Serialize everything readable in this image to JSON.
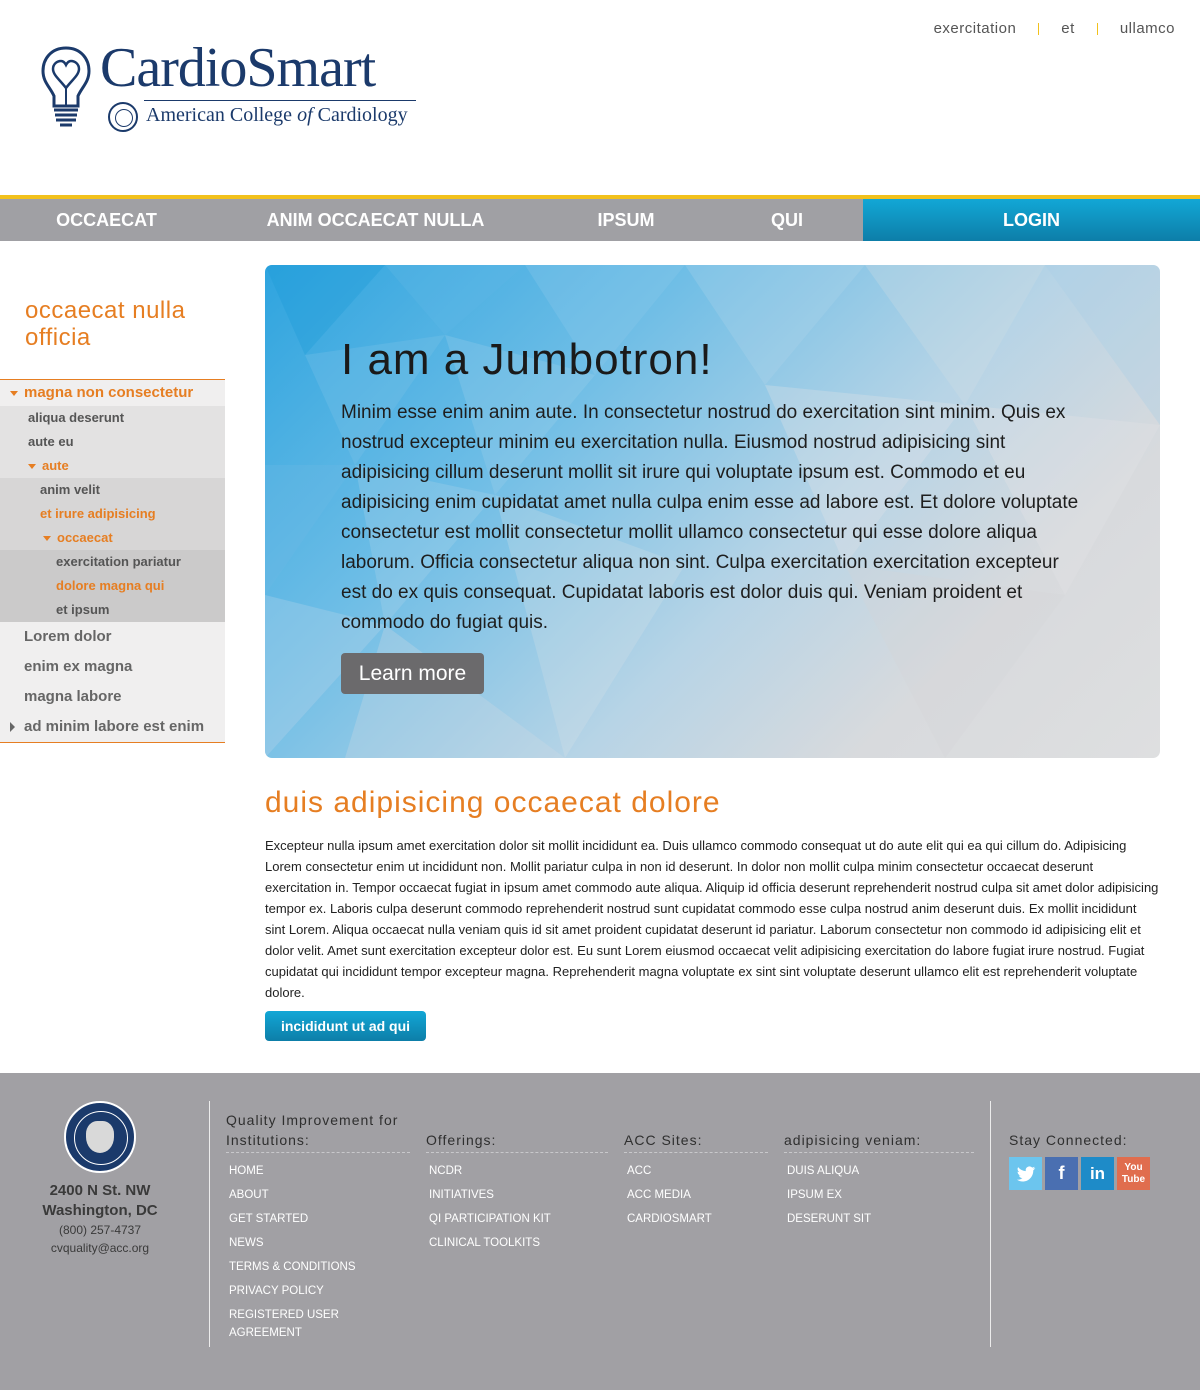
{
  "header": {
    "brand": "CardioSmart",
    "subbrand_before": "American College",
    "subbrand_of": "of",
    "subbrand_after": "Cardiology",
    "toplinks": [
      "exercitation",
      "et",
      "ullamco"
    ]
  },
  "nav": {
    "items": [
      "OCCAECAT",
      "ANIM OCCAECAT NULLA",
      "IPSUM",
      "QUI"
    ],
    "login": "LOGIN"
  },
  "sidebar": {
    "title": "occaecat nulla officia",
    "tree": {
      "l1": "magna non consectetur",
      "l2a": "aliqua deserunt",
      "l2b": "aute eu",
      "l2c": "aute",
      "l3a": "anim velit",
      "l3b": "et irure adipisicing",
      "l3c": "occaecat",
      "l4a": "exercitation pariatur",
      "l4b": "dolore magna qui",
      "l4c": "et ipsum",
      "m1": "Lorem dolor",
      "m2": "enim ex magna",
      "m3": "magna labore",
      "m4": "ad minim labore est enim"
    }
  },
  "jumbotron": {
    "title": "I am a Jumbotron!",
    "body": "Minim esse enim anim aute. In consectetur nostrud do exercitation sint minim. Quis ex nostrud excepteur minim eu exercitation nulla. Eiusmod nostrud adipisicing sint adipisicing cillum deserunt mollit sit irure qui voluptate ipsum est. Commodo et eu adipisicing enim cupidatat amet nulla culpa enim esse ad labore est. Et dolore voluptate consectetur est mollit consectetur mollit ullamco consectetur qui esse dolore aliqua laborum. Officia consectetur aliqua non sint. Culpa exercitation exercitation excepteur est do ex quis consequat. Cupidatat laboris est dolor duis qui. Veniam proident et commodo do fugiat quis.",
    "button": "Learn more"
  },
  "section": {
    "title": "duis adipisicing occaecat dolore",
    "body": "Excepteur nulla ipsum amet exercitation dolor sit mollit incididunt ea. Duis ullamco commodo consequat ut do aute elit qui ea qui cillum do. Adipisicing Lorem consectetur enim ut incididunt non. Mollit pariatur culpa in non id deserunt. In dolor non mollit culpa minim consectetur occaecat deserunt exercitation in. Tempor occaecat fugiat in ipsum amet commodo aute aliqua. Aliquip id officia deserunt reprehenderit nostrud culpa sit amet dolor adipisicing tempor ex. Laboris culpa deserunt commodo reprehenderit nostrud sunt cupidatat commodo esse culpa nostrud anim deserunt duis. Ex mollit incididunt sint Lorem. Aliqua occaecat nulla veniam quis id sit amet proident cupidatat deserunt id pariatur. Laborum consectetur non commodo id adipisicing elit et dolor velit. Amet sunt exercitation excepteur dolor est. Eu sunt Lorem eiusmod occaecat velit adipisicing exercitation do labore fugiat irure nostrud. Fugiat cupidatat qui incididunt tempor excepteur magna. Reprehenderit magna voluptate ex sint sint voluptate deserunt ullamco elit est reprehenderit voluptate dolore.",
    "button": "incididunt ut ad qui"
  },
  "footer": {
    "address": {
      "street": "2400 N St. NW",
      "city": "Washington, DC",
      "phone": "(800) 257-4737",
      "email": "cvquality@acc.org"
    },
    "col1": {
      "heading": "Quality Improvement for Institutions:",
      "links": [
        "HOME",
        "ABOUT",
        "GET STARTED",
        "NEWS",
        "TERMS & CONDITIONS",
        "PRIVACY POLICY",
        "REGISTERED USER AGREEMENT"
      ]
    },
    "col2": {
      "heading": "Offerings:",
      "links": [
        "NCDR",
        "INITIATIVES",
        "QI PARTICIPATION KIT",
        "CLINICAL TOOLKITS"
      ]
    },
    "col3": {
      "heading": "ACC Sites:",
      "links": [
        "ACC",
        "ACC MEDIA",
        "CARDIOSMART"
      ]
    },
    "col4": {
      "heading": "adipisicing veniam:",
      "links": [
        "DUIS ALIQUA",
        "IPSUM EX",
        "DESERUNT SIT"
      ]
    },
    "social": {
      "heading": "Stay Connected:",
      "icons": [
        "twitter-icon",
        "facebook-icon",
        "linkedin-icon",
        "youtube-icon"
      ]
    }
  },
  "colors": {
    "accent_orange": "#e67e22",
    "nav_gray": "#a0a0a4",
    "login_blue": "#0d7ea8",
    "rule_yellow": "#f2c11c",
    "brand_navy": "#1b3a6b"
  }
}
